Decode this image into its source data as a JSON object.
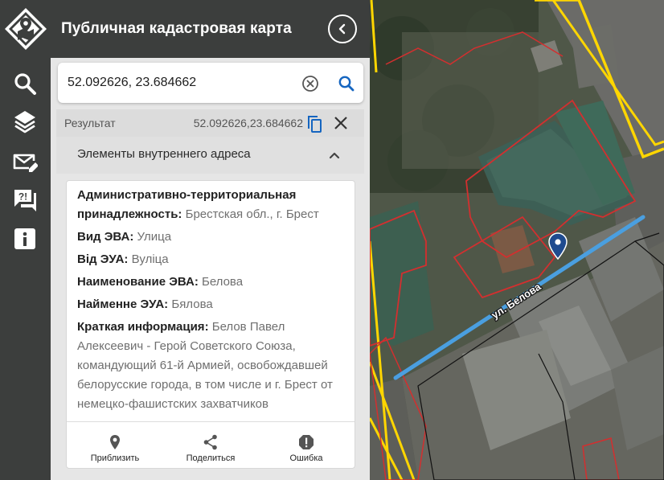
{
  "app": {
    "title": "Публичная кадастровая карта"
  },
  "search": {
    "value": "52.092626, 23.684662"
  },
  "result": {
    "label": "Результат",
    "coords": "52.092626,23.684662"
  },
  "section": {
    "title": "Элементы внутреннего адреса"
  },
  "info": [
    {
      "key": "Административно-территориальная принадлежность",
      "value": "Брестская обл., г. Брест"
    },
    {
      "key": "Вид ЭВА",
      "value": "Улица"
    },
    {
      "key": "Від ЭУА",
      "value": "Вуліца"
    },
    {
      "key": "Наименование ЭВА",
      "value": "Белова"
    },
    {
      "key": "Найменне ЭУА",
      "value": "Бялова"
    },
    {
      "key": "Краткая информация",
      "value": "Белов Павел Алексеевич - Герой Советского Союза, командующий 61-й Армией, освобождавшей белорусские города, в том числе и г. Брест от немецко-фашистских захватчиков"
    }
  ],
  "actions": {
    "zoom": "Приблизить",
    "share": "Поделиться",
    "error": "Ошибка"
  },
  "map": {
    "street_label": "ул. Белова"
  },
  "icons": {
    "rail": [
      "search-icon",
      "layers-icon",
      "mail-edit-icon",
      "feedback-icon",
      "info-icon"
    ],
    "header": "chevron-left-icon",
    "search": [
      "clear-icon",
      "search-icon"
    ],
    "result": [
      "copy-icon",
      "close-icon"
    ],
    "actions": [
      "location-pin-icon",
      "share-icon",
      "error-icon"
    ],
    "map_marker": "map-pin-icon"
  },
  "colors": {
    "sidebar": "#3c3e3d",
    "panel": "#e6e6e6",
    "accent": "#1565c0",
    "parcel_border": "#d32f2f",
    "road_line": "#ffd600",
    "street_line": "#4a9fe0"
  }
}
